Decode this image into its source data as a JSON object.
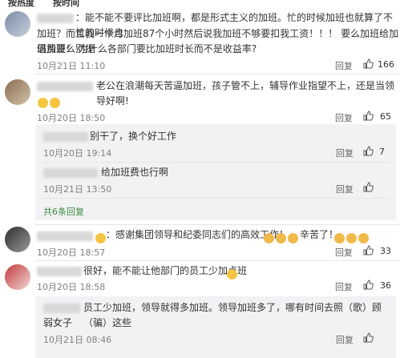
{
  "tabs": [
    "按热度",
    "按时间"
  ],
  "comments": [
    {
      "text1": "：能不能不要评比加班啊，都是形式主义的加班。忙的时候加班也就算了不忙的时候也",
      "text2": "加班？而且我一个月加班87个小时然后说我加班不够要扣我工资！！！ 要么加班给加班费要么别提",
      "text3": "倡加班！ 为什么各部门要比加班时长而不是收益率?",
      "date": "10月21日 11:10",
      "reply_label": "回复",
      "likes": "166"
    },
    {
      "text1": "老公在浪潮每天苦逼加班，孩子管不上，辅导作业指望不上，还是当领导好啊!",
      "date": "10月20日 18:50",
      "reply_label": "回复",
      "likes": "65",
      "replies": [
        {
          "text": "别干了，换个好工作",
          "date": "10月20日 19:14",
          "reply_label": "回复",
          "likes": "7"
        },
        {
          "text": "给加班费也行啊",
          "date": "10月21日 13:50",
          "reply_label": "回复",
          "likes": ""
        }
      ],
      "more": "共6条回复"
    },
    {
      "text1": "：感谢集团领导和纪委同志们的高效工作！",
      "text_tail": "辛苦了！",
      "date": "10月20日 18:57",
      "reply_label": "回复",
      "likes": "33"
    },
    {
      "text1": "很好，能不能让他部门的员工少加点班",
      "date": "10月20日 18:58",
      "reply_label": "回复",
      "likes": "36",
      "replies": [
        {
          "text": "员工少加班，领导就得多加班。领导加班多了，哪有时间去照（歌）顾（骗）这些",
          "text2": "弱女子",
          "date": "10月21日 08:46",
          "reply_label": "回复",
          "likes": ""
        }
      ]
    }
  ],
  "colors": {
    "more_link": "#3f8c3f",
    "reply_bg": "#f2f2f5",
    "meta": "#808080"
  }
}
